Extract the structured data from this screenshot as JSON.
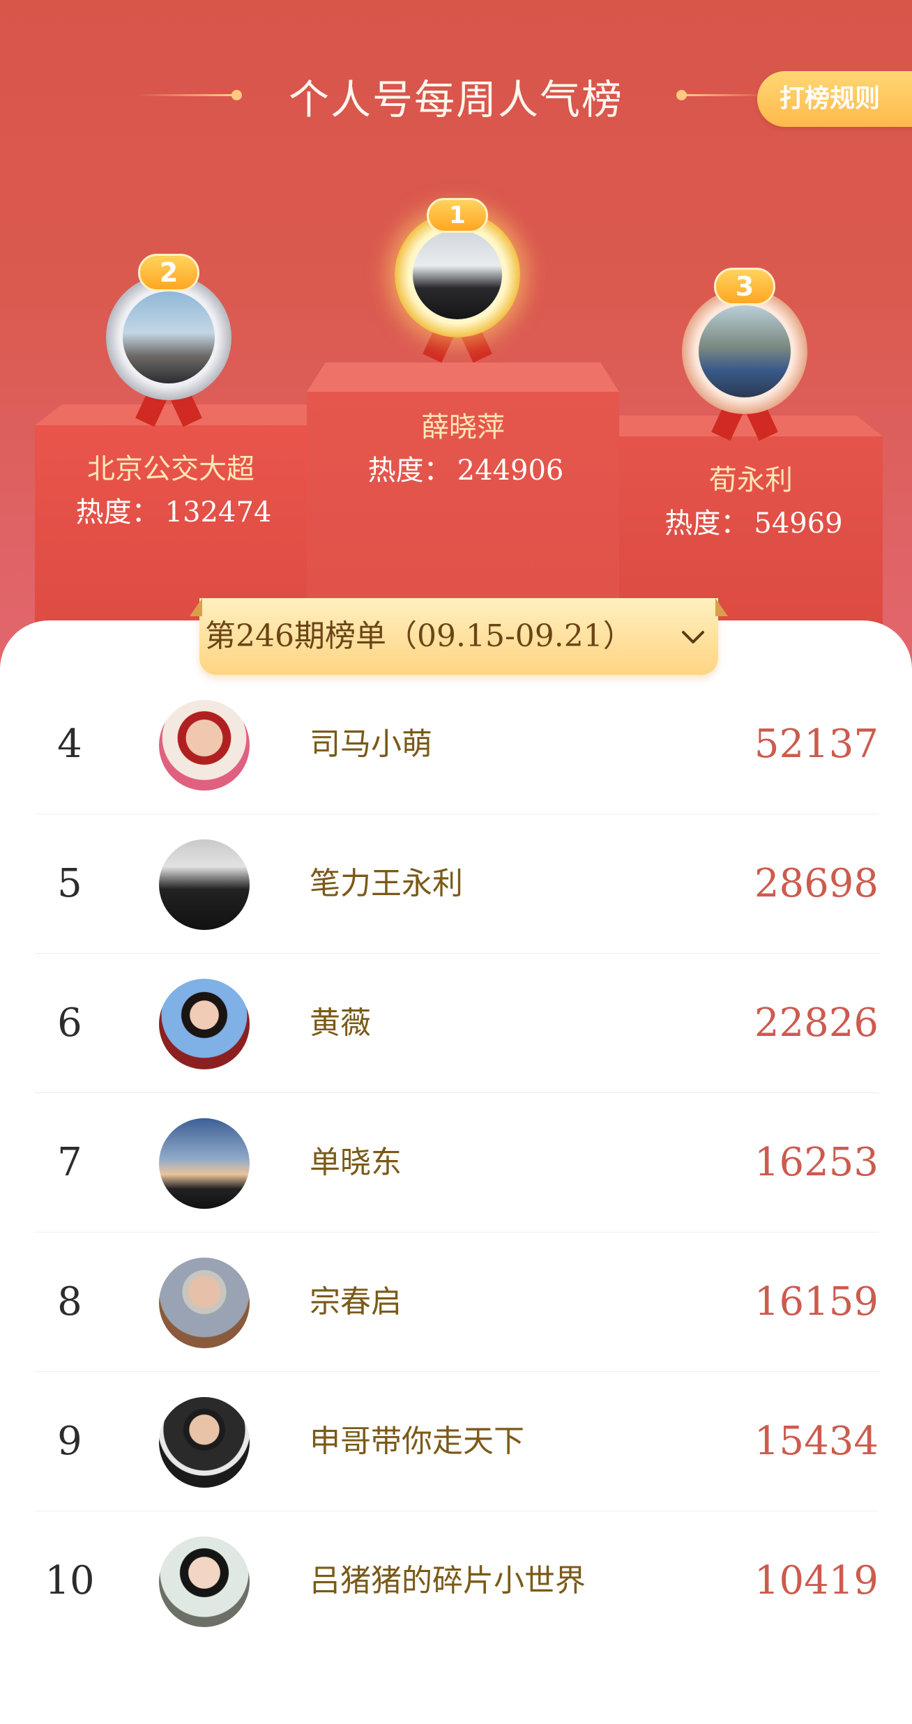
{
  "header": {
    "title": "个人号每周人气榜",
    "rules_button": "打榜规则"
  },
  "podium": {
    "first": {
      "rank": "1",
      "name": "薛晓萍",
      "heat_label": "热度：",
      "heat": "244906"
    },
    "second": {
      "rank": "2",
      "name": "北京公交大超",
      "heat_label": "热度：",
      "heat": "132474"
    },
    "third": {
      "rank": "3",
      "name": "荀永利",
      "heat_label": "热度：",
      "heat": "54969"
    }
  },
  "period": {
    "label": "第246期榜单（09.15-09.21）",
    "icon": "chevron-down-icon"
  },
  "list": [
    {
      "rank": "4",
      "name": "司马小萌",
      "score": "52137"
    },
    {
      "rank": "5",
      "name": "笔力王永利",
      "score": "28698"
    },
    {
      "rank": "6",
      "name": "黄薇",
      "score": "22826"
    },
    {
      "rank": "7",
      "name": "单晓东",
      "score": "16253"
    },
    {
      "rank": "8",
      "name": "宗春启",
      "score": "16159"
    },
    {
      "rank": "9",
      "name": "申哥带你走天下",
      "score": "15434"
    },
    {
      "rank": "10",
      "name": "吕猪猪的碎片小世界",
      "score": "10419"
    }
  ],
  "colors": {
    "hero_bg": "#d8554a",
    "score": "#cc5b4e",
    "name": "#7a5a18",
    "gold": "#ffb94c"
  }
}
